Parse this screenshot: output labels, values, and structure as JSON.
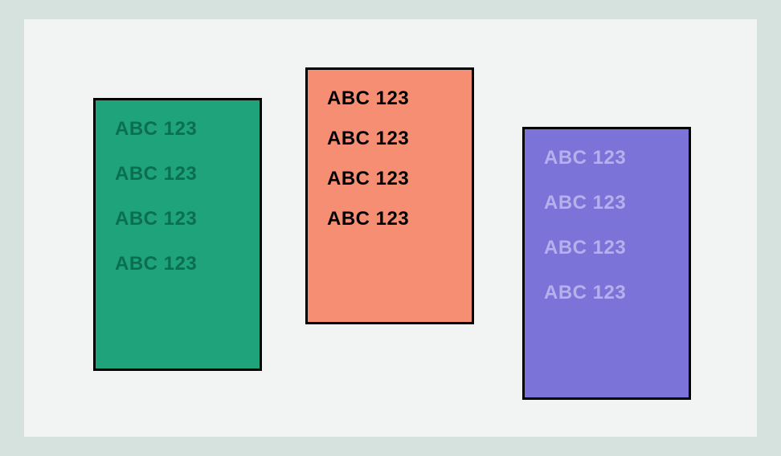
{
  "cards": [
    {
      "name": "green",
      "lines": [
        "ABC 123",
        "ABC 123",
        "ABC 123",
        "ABC 123"
      ]
    },
    {
      "name": "orange",
      "lines": [
        "ABC 123",
        "ABC 123",
        "ABC 123",
        "ABC 123"
      ]
    },
    {
      "name": "purple",
      "lines": [
        "ABC 123",
        "ABC 123",
        "ABC 123",
        "ABC 123"
      ]
    }
  ]
}
